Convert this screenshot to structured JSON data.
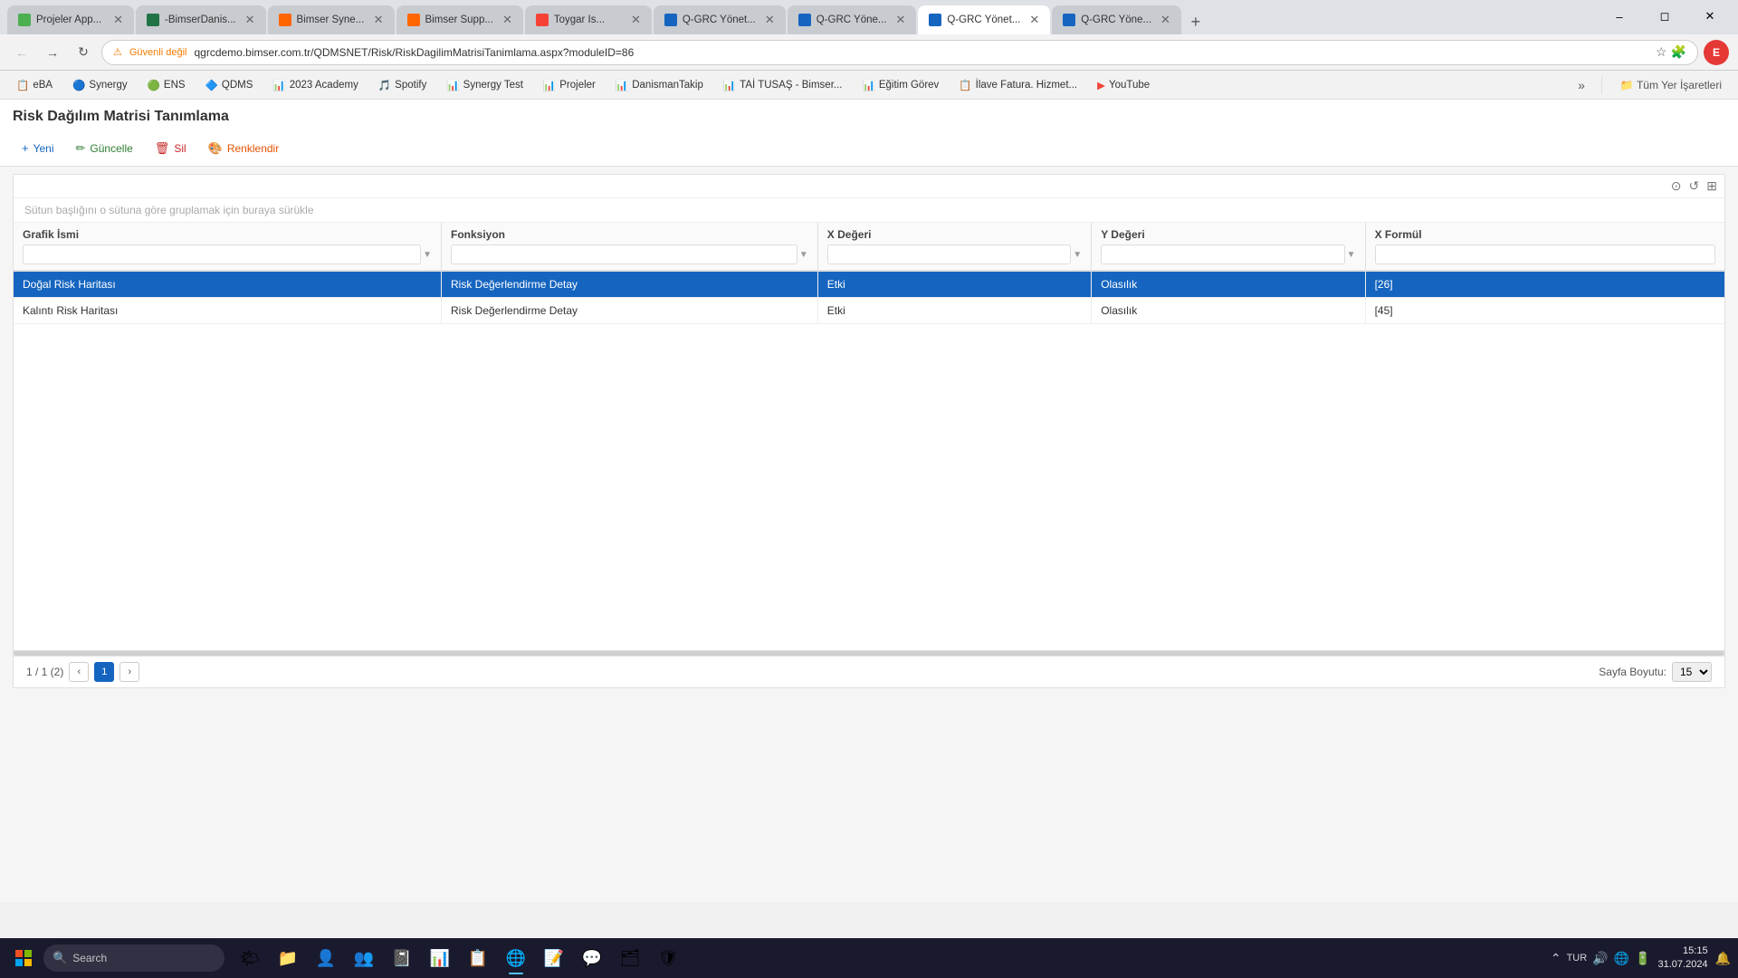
{
  "browser": {
    "tabs": [
      {
        "id": "t1",
        "label": "Projeler App...",
        "favicon_color": "#4caf50",
        "active": false,
        "closable": true
      },
      {
        "id": "t2",
        "label": "-BimserDanis...",
        "favicon_color": "#217346",
        "active": false,
        "closable": true
      },
      {
        "id": "t3",
        "label": "Bimser Syne...",
        "favicon_color": "#ff6600",
        "active": false,
        "closable": true
      },
      {
        "id": "t4",
        "label": "Bimser Supp...",
        "favicon_color": "#ff6600",
        "active": false,
        "closable": true
      },
      {
        "id": "t5",
        "label": "Toygar Is...",
        "favicon_color": "#f44336",
        "active": false,
        "closable": true
      },
      {
        "id": "t6",
        "label": "Q-GRC Yönet...",
        "favicon_color": "#1565c0",
        "active": false,
        "closable": true
      },
      {
        "id": "t7",
        "label": "Q-GRC Yöne...",
        "favicon_color": "#1565c0",
        "active": false,
        "closable": true
      },
      {
        "id": "t8",
        "label": "Q-GRC Yönet...",
        "favicon_color": "#1565c0",
        "active": true,
        "closable": true
      },
      {
        "id": "t9",
        "label": "Q-GRC Yöne...",
        "favicon_color": "#1565c0",
        "active": false,
        "closable": true
      }
    ],
    "address": "qgrcdemo.bimser.com.tr/QDMSNET/Risk/RiskDagilimMatrisiTanimlama.aspx?moduleID=86",
    "lock_text": "Güvenli değil"
  },
  "bookmarks": [
    {
      "label": "eBA",
      "icon": "📋"
    },
    {
      "label": "Synergy",
      "icon": "🔵"
    },
    {
      "label": "ENS",
      "icon": "🟢"
    },
    {
      "label": "QDMS",
      "icon": "🔷"
    },
    {
      "label": "2023 Academy",
      "icon": "📊"
    },
    {
      "label": "Spotify",
      "icon": "🎵"
    },
    {
      "label": "Synergy Test",
      "icon": "📊"
    },
    {
      "label": "Projeler",
      "icon": "📊"
    },
    {
      "label": "DanismanTakip",
      "icon": "📊"
    },
    {
      "label": "TAİ TUSAŞ - Bimser...",
      "icon": "📊"
    },
    {
      "label": "Eğitim Görev",
      "icon": "📊"
    },
    {
      "label": "İlave Fatura. Hizmet...",
      "icon": "📋"
    },
    {
      "label": "YouTube",
      "icon": "▶"
    }
  ],
  "page": {
    "title": "Risk Dağılım Matrisi Tanımlama",
    "toolbar": {
      "new_label": "Yeni",
      "update_label": "Güncelle",
      "delete_label": "Sil",
      "colorize_label": "Renklendir"
    },
    "grid": {
      "group_hint": "Sütun başlığını o sütuna göre gruplamak için buraya sürükle",
      "columns": [
        {
          "key": "grafik_ismi",
          "label": "Grafik İsmi"
        },
        {
          "key": "fonksiyon",
          "label": "Fonksiyon"
        },
        {
          "key": "x_degeri",
          "label": "X Değeri"
        },
        {
          "key": "y_degeri",
          "label": "Y Değeri"
        },
        {
          "key": "x_formul",
          "label": "X Formül"
        }
      ],
      "rows": [
        {
          "grafik_ismi": "Doğal Risk Haritası",
          "fonksiyon": "Risk Değerlendirme Detay",
          "x_degeri": "Etki",
          "y_degeri": "Olasılık",
          "x_formul": "[26]",
          "selected": true
        },
        {
          "grafik_ismi": "Kalıntı Risk Haritası",
          "fonksiyon": "Risk Değerlendirme Detay",
          "x_degeri": "Etki",
          "y_degeri": "Olasılık",
          "x_formul": "[45]",
          "selected": false
        }
      ],
      "pagination": {
        "info": "1 / 1 (2)",
        "current_page": "1",
        "page_size_label": "Sayfa Boyutu:",
        "page_size": "15"
      }
    }
  },
  "taskbar": {
    "search_placeholder": "Search",
    "time": "15:15",
    "date": "31.07.2024",
    "language": "TUR"
  }
}
